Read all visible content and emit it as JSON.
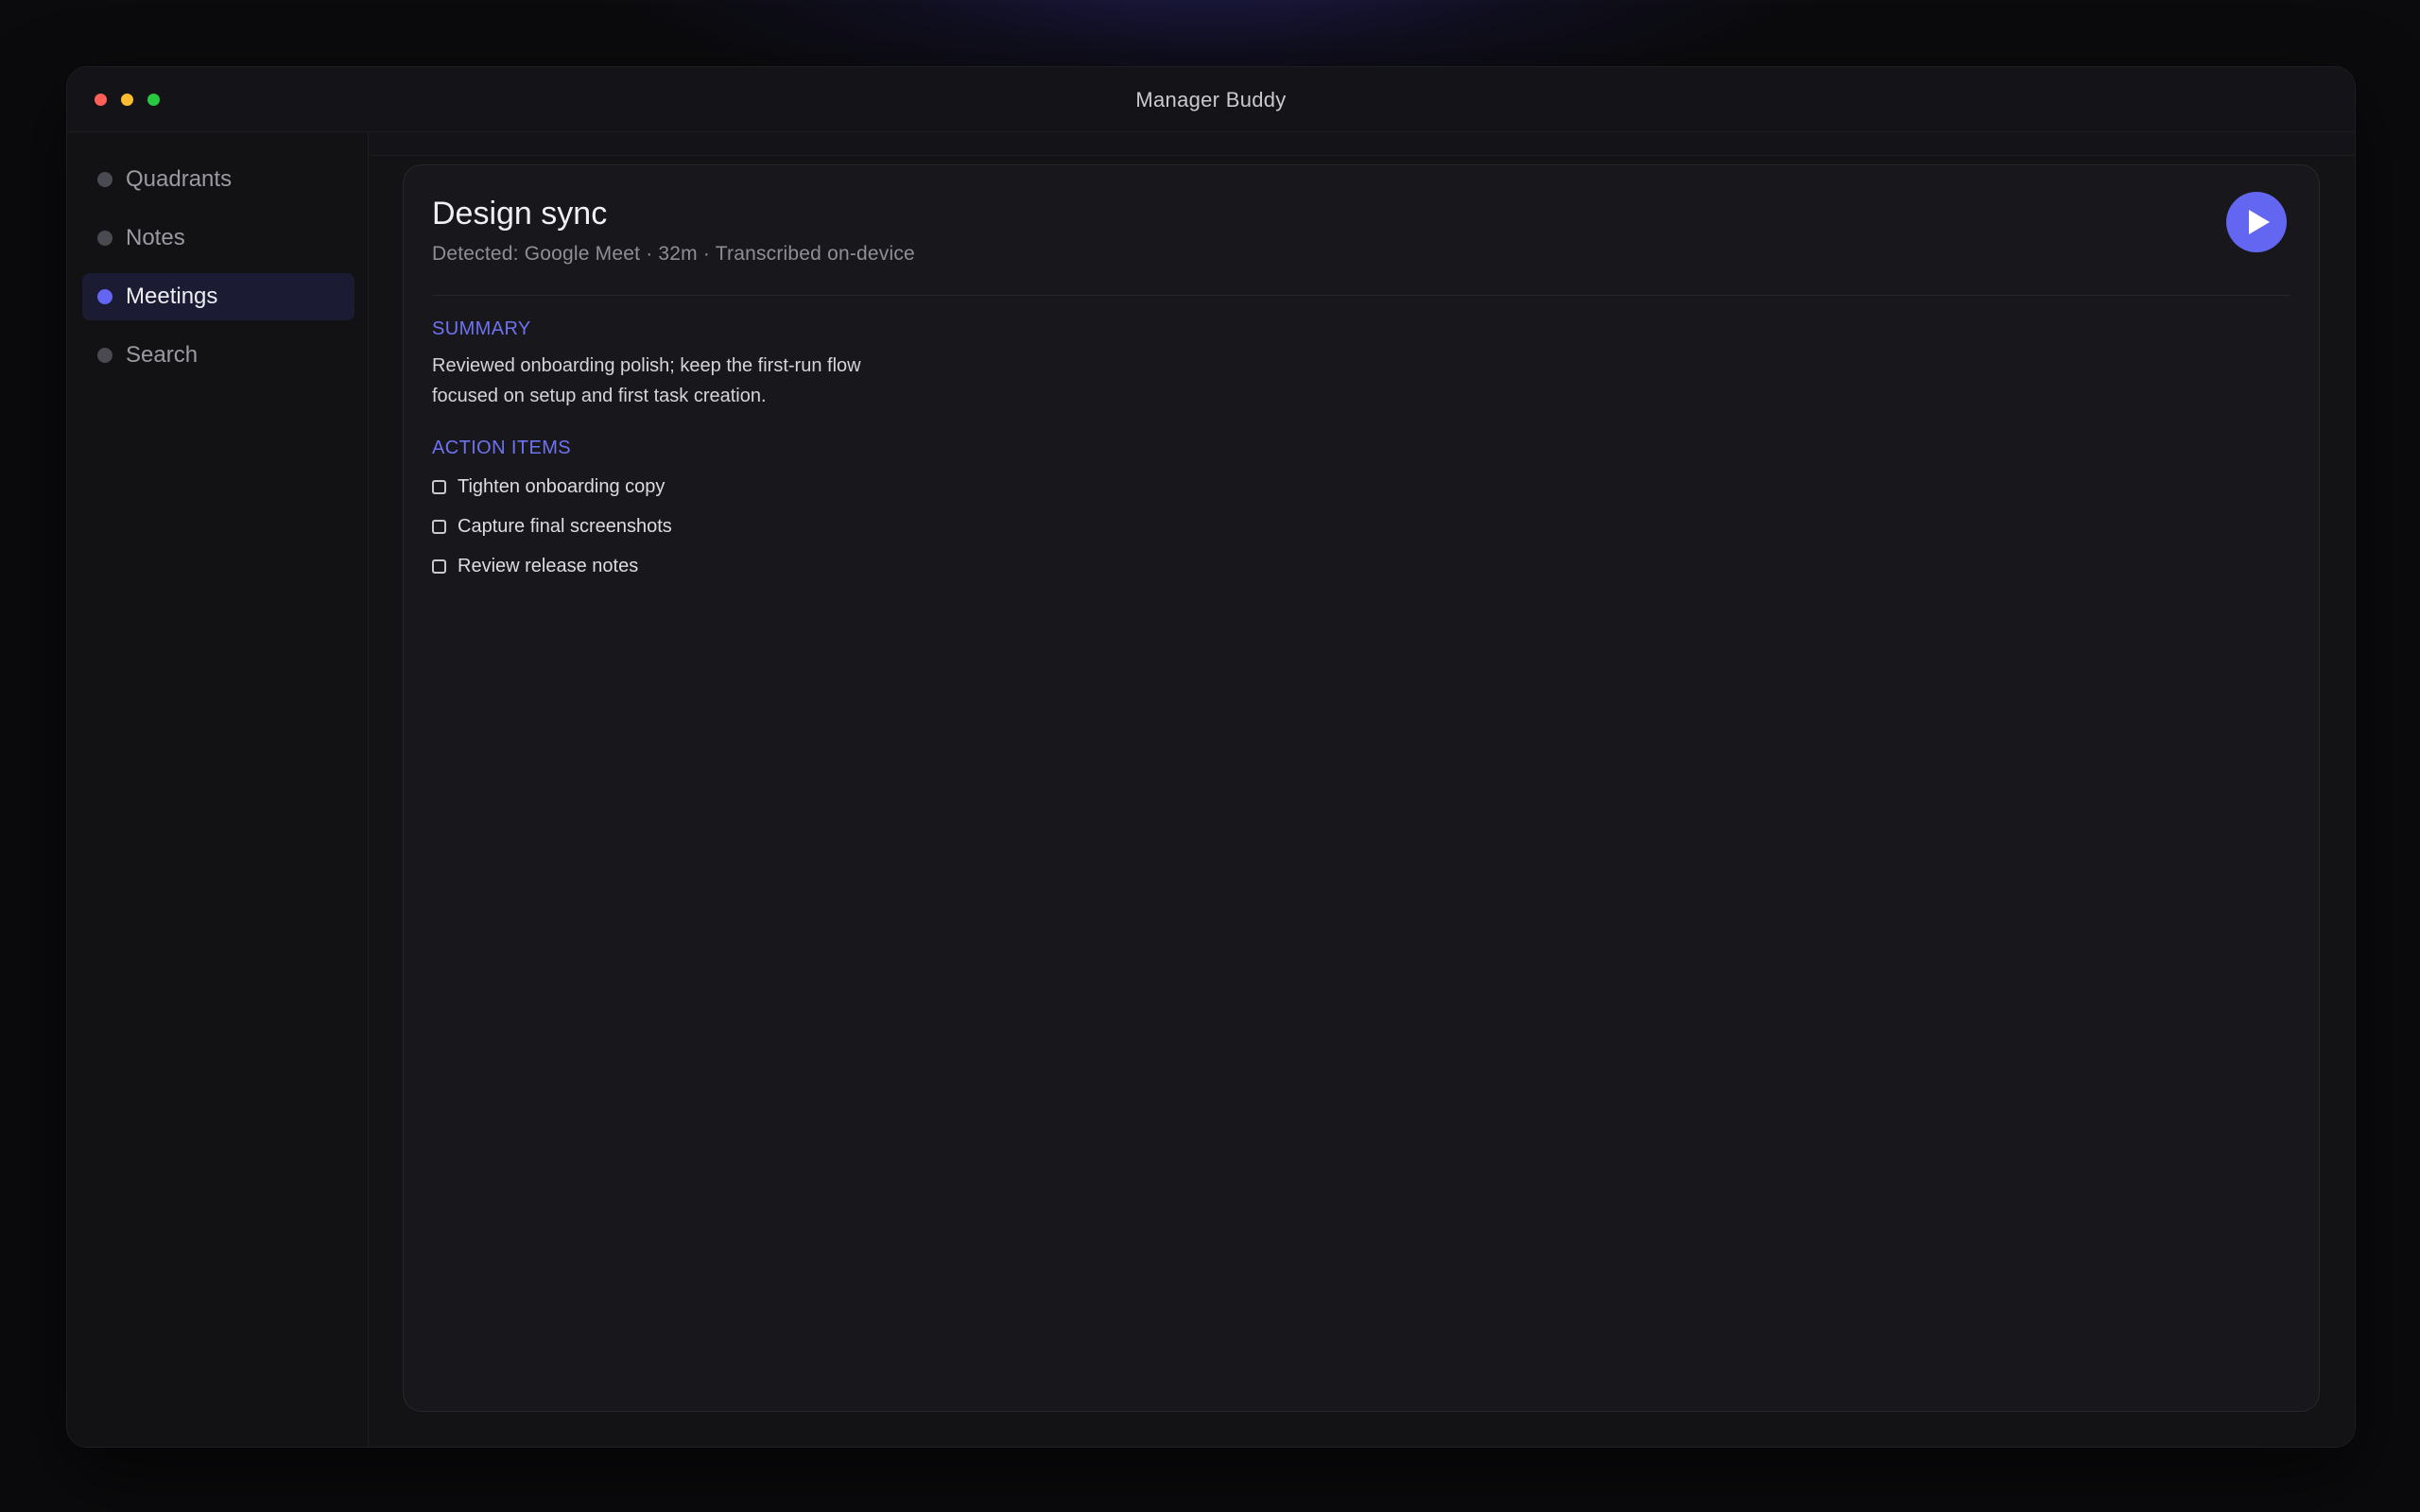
{
  "app": {
    "title": "Manager Buddy"
  },
  "sidebar": {
    "items": [
      {
        "label": "Quadrants",
        "active": false
      },
      {
        "label": "Notes",
        "active": false
      },
      {
        "label": "Meetings",
        "active": true
      },
      {
        "label": "Search",
        "active": false
      }
    ]
  },
  "meeting": {
    "title": "Design sync",
    "meta": "Detected: Google Meet · 32m · Transcribed on-device",
    "summary_heading": "SUMMARY",
    "summary_line_1": "Reviewed onboarding polish; keep the first-run flow",
    "summary_line_2": "focused on setup and first task creation.",
    "action_items_heading": "ACTION ITEMS",
    "action_items": [
      {
        "label": "Tighten onboarding copy",
        "checked": false
      },
      {
        "label": "Capture final screenshots",
        "checked": false
      },
      {
        "label": "Review release notes",
        "checked": false
      }
    ]
  },
  "icons": {
    "play": "play-icon"
  },
  "colors": {
    "accent": "#6366f1",
    "window_bg": "#121215",
    "card_bg": "#18181c",
    "close": "#ff5f57",
    "minimize": "#febc2e",
    "zoom": "#28c840"
  }
}
